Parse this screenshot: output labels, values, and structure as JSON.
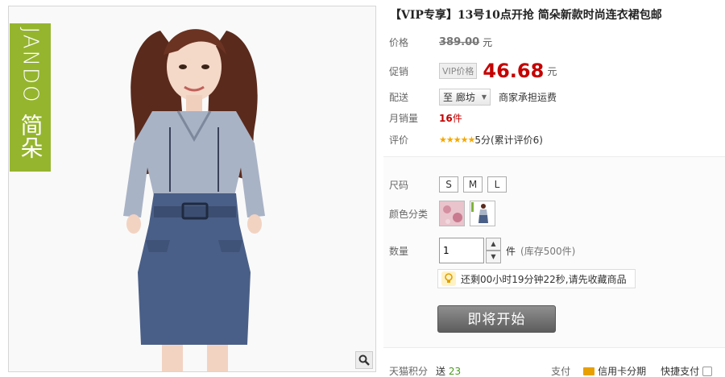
{
  "brand": {
    "logo_text_en": "JANDO",
    "logo_text_cn": "简朵",
    "accent_color": "#95b52e"
  },
  "product": {
    "title": "【VIP专享】13号10点开抢 简朵新款时尚连衣裙包邮",
    "price": {
      "label": "价格",
      "original": "389.00",
      "unit": "元"
    },
    "promo": {
      "label": "促销",
      "badge": "VIP价格",
      "price": "46.68",
      "unit": "元",
      "color": "#c40000"
    },
    "shipping": {
      "label": "配送",
      "to_prefix": "至",
      "location": "廊坊",
      "note": "商家承担运费"
    },
    "monthly_sales": {
      "label": "月销量",
      "count": "16",
      "unit": "件"
    },
    "rating": {
      "label": "评价",
      "stars": "★★★★★",
      "score_text": "5分(累计评价6)",
      "star_count": 5
    }
  },
  "sku": {
    "size_label": "尺码",
    "sizes": [
      "S",
      "M",
      "L"
    ],
    "color_label": "颜色分类",
    "colors": [
      "pink-floral-swatch",
      "denim-dress-swatch"
    ],
    "quantity_label": "数量",
    "quantity_value": "1",
    "quantity_unit": "件",
    "stock_text": "(库存500件)",
    "tip_text": "还剩00小时19分钟22秒,请先收藏商品",
    "cta_label": "即将开始"
  },
  "footer": {
    "points_label": "天猫积分",
    "points_prefix": "送",
    "points_value": "23",
    "pay_label": "支付",
    "credit_label": "信用卡分期",
    "quick_pay_label": "快捷支付"
  },
  "icons": {
    "zoom": "magnifier-icon",
    "bulb": "lightbulb-icon",
    "dropdown": "triangle-down-icon"
  }
}
